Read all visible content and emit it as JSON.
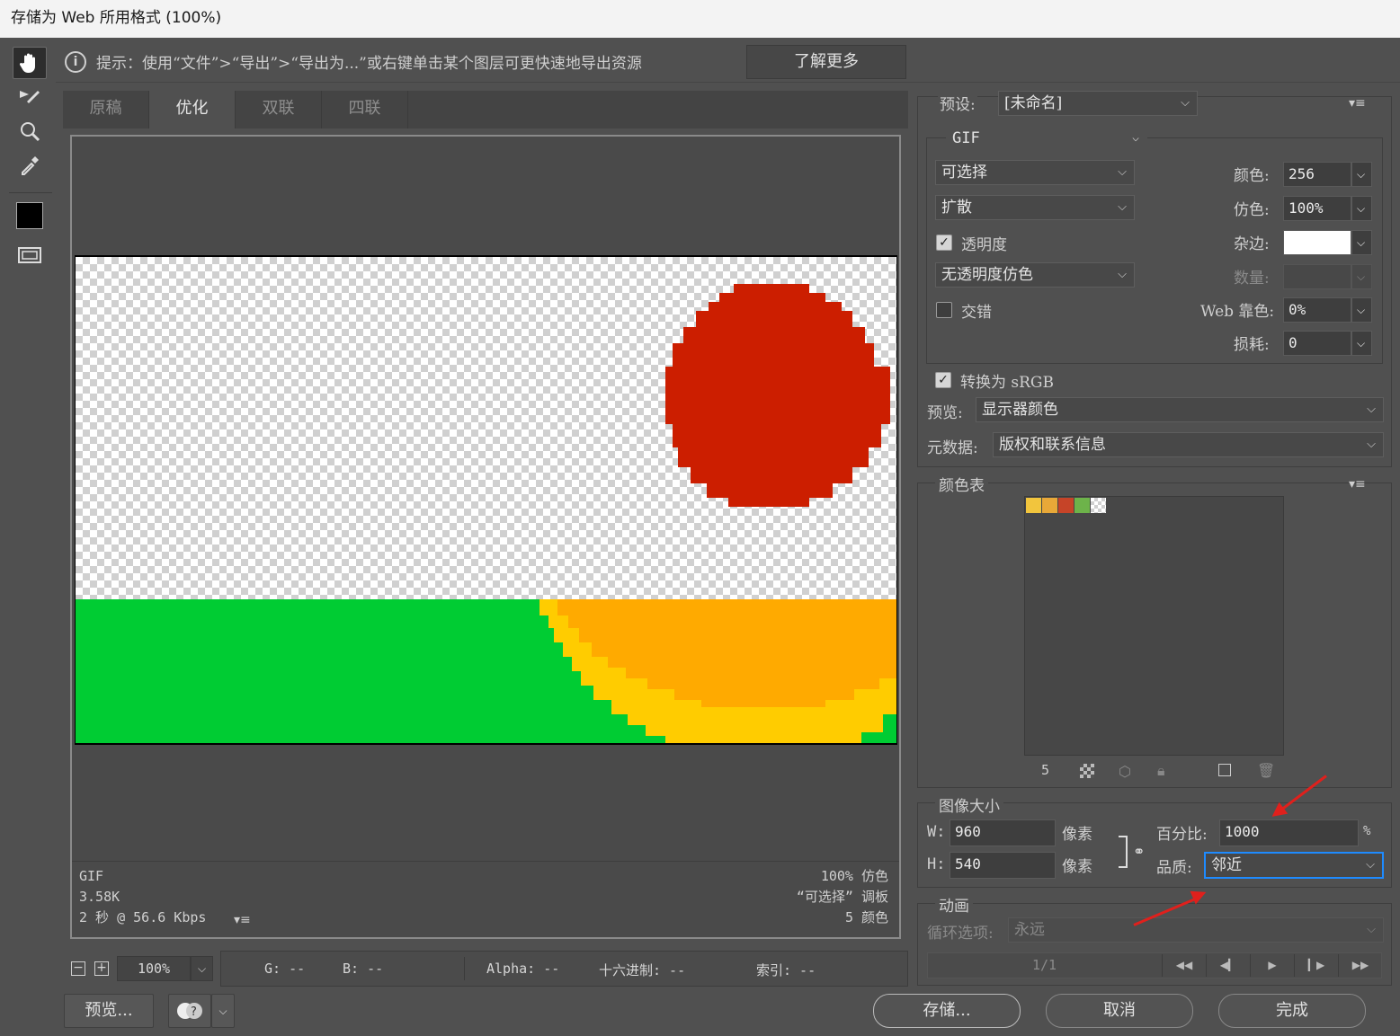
{
  "window": {
    "title": "存储为 Web 所用格式 (100%)"
  },
  "hint": {
    "text": "提示：使用“文件”>“导出”>“导出为...”或右键单击某个图层可更快速地导出资源",
    "learn_more": "了解更多"
  },
  "tabs": [
    {
      "label": "原稿"
    },
    {
      "label": "优化"
    },
    {
      "label": "双联"
    },
    {
      "label": "四联"
    }
  ],
  "canvas_info": {
    "format": "GIF",
    "size": "3.58K",
    "time": "2 秒 @ 56.6 Kbps",
    "dither": "100% 仿色",
    "palette": "“可选择” 调板",
    "colors": "5 颜色"
  },
  "zoom": {
    "value": "100%",
    "minus": "−",
    "plus": "+"
  },
  "status": {
    "g": "G: --",
    "b": "B: --",
    "alpha": "Alpha: --",
    "hex": "十六进制: --",
    "index": "索引: --"
  },
  "buttons": {
    "preview": "预览...",
    "save": "存储...",
    "cancel": "取消",
    "done": "完成"
  },
  "settings": {
    "preset_label": "预设:",
    "preset_value": "[未命名]",
    "format": "GIF",
    "reduction": "可选择",
    "dither_algo": "扩散",
    "transparency_label": "透明度",
    "transparency_checked": true,
    "transparency_dither": "无透明度仿色",
    "interlaced_label": "交错",
    "interlaced_checked": false,
    "colors_label": "颜色:",
    "colors_value": "256",
    "dither_label": "仿色:",
    "dither_value": "100%",
    "matte_label": "杂边:",
    "matte_color": "#ffffff",
    "amount_label": "数量:",
    "websnap_label": "Web 靠色:",
    "websnap_value": "0%",
    "lossy_label": "损耗:",
    "lossy_value": "0",
    "srgb_label": "转换为 sRGB",
    "srgb_checked": true,
    "preview_label": "预览:",
    "preview_value": "显示器颜色",
    "metadata_label": "元数据:",
    "metadata_value": "版权和联系信息"
  },
  "color_table": {
    "title": "颜色表",
    "swatches": [
      "#f2c53d",
      "#e8a838",
      "#c64428",
      "#6db34a",
      "checker"
    ],
    "count": "5"
  },
  "image_size": {
    "title": "图像大小",
    "w_label": "W:",
    "w_value": "960",
    "w_unit": "像素",
    "h_label": "H:",
    "h_value": "540",
    "h_unit": "像素",
    "percent_label": "百分比:",
    "percent_value": "1000",
    "percent_unit": "%",
    "quality_label": "品质:",
    "quality_value": "邻近"
  },
  "animation": {
    "title": "动画",
    "loop_label": "循环选项:",
    "loop_value": "永远",
    "frame": "1/1"
  },
  "colors": {
    "accent": "#1e8bff",
    "sun": "#cc1e00",
    "grass": "#00cc33",
    "sand": "#ffaa00",
    "sand_edge": "#ffcc00",
    "arrow": "#e0201c"
  }
}
